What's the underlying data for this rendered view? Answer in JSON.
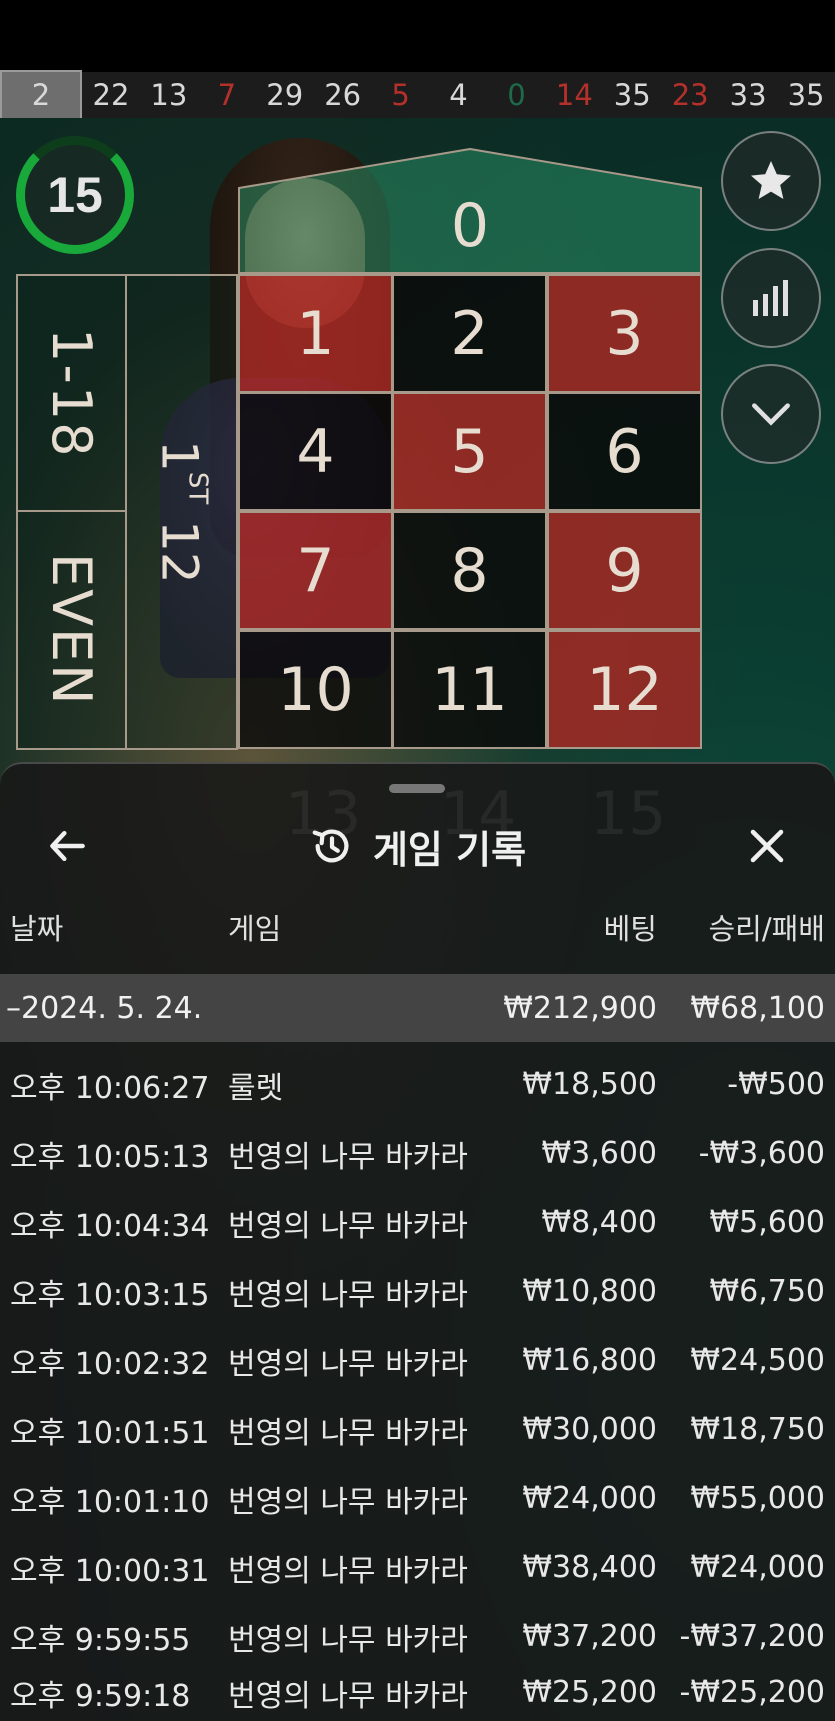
{
  "recent_results": [
    {
      "n": "2",
      "color": "gray"
    },
    {
      "n": "22",
      "color": "white"
    },
    {
      "n": "13",
      "color": "white"
    },
    {
      "n": "7",
      "color": "red"
    },
    {
      "n": "29",
      "color": "white"
    },
    {
      "n": "26",
      "color": "white"
    },
    {
      "n": "5",
      "color": "red"
    },
    {
      "n": "4",
      "color": "white"
    },
    {
      "n": "0",
      "color": "green"
    },
    {
      "n": "14",
      "color": "red"
    },
    {
      "n": "35",
      "color": "white"
    },
    {
      "n": "23",
      "color": "red"
    },
    {
      "n": "33",
      "color": "white"
    },
    {
      "n": "35",
      "color": "white"
    }
  ],
  "timer": "15",
  "board": {
    "zero": "0",
    "numbers": [
      "1",
      "2",
      "3",
      "4",
      "5",
      "6",
      "7",
      "8",
      "9",
      "10",
      "11",
      "12"
    ],
    "low_label": "1-18",
    "even_label": "EVEN",
    "dozen_label": "1",
    "dozen_sup": "ST",
    "dozen_num": "12"
  },
  "panel": {
    "title": "게임 기록",
    "columns": {
      "date": "날짜",
      "game": "게임",
      "bet": "베팅",
      "win": "승리/패배"
    },
    "date_row": {
      "label": "–2024. 5. 24.",
      "bet": "₩212,900",
      "win": "₩68,100"
    },
    "rows": [
      {
        "time": "오후 10:06:27",
        "game": "룰렛",
        "bet": "₩18,500",
        "win": "-₩500"
      },
      {
        "time": "오후 10:05:13",
        "game": "번영의 나무 바카라",
        "bet": "₩3,600",
        "win": "-₩3,600"
      },
      {
        "time": "오후 10:04:34",
        "game": "번영의 나무 바카라",
        "bet": "₩8,400",
        "win": "₩5,600"
      },
      {
        "time": "오후 10:03:15",
        "game": "번영의 나무 바카라",
        "bet": "₩10,800",
        "win": "₩6,750"
      },
      {
        "time": "오후 10:02:32",
        "game": "번영의 나무 바카라",
        "bet": "₩16,800",
        "win": "₩24,500"
      },
      {
        "time": "오후 10:01:51",
        "game": "번영의 나무 바카라",
        "bet": "₩30,000",
        "win": "₩18,750"
      },
      {
        "time": "오후 10:01:10",
        "game": "번영의 나무 바카라",
        "bet": "₩24,000",
        "win": "₩55,000"
      },
      {
        "time": "오후 10:00:31",
        "game": "번영의 나무 바카라",
        "bet": "₩38,400",
        "win": "₩24,000"
      },
      {
        "time": "오후 9:59:55",
        "game": "번영의 나무 바카라",
        "bet": "₩37,200",
        "win": "-₩37,200"
      },
      {
        "time": "오후 9:59:18",
        "game": "번영의 나무 바카라",
        "bet": "₩25,200",
        "win": "-₩25,200"
      }
    ]
  },
  "icons": {
    "back": "arrow-left-icon",
    "history": "history-icon",
    "close": "close-icon",
    "favorite": "star-icon",
    "stats": "statistics-icon",
    "collapse": "chevron-down-icon"
  },
  "colors": {
    "timer_green": "#19a83a",
    "red_cell": "#aa2823",
    "red_result": "#b4302a",
    "green_result": "#1e6a4a"
  }
}
